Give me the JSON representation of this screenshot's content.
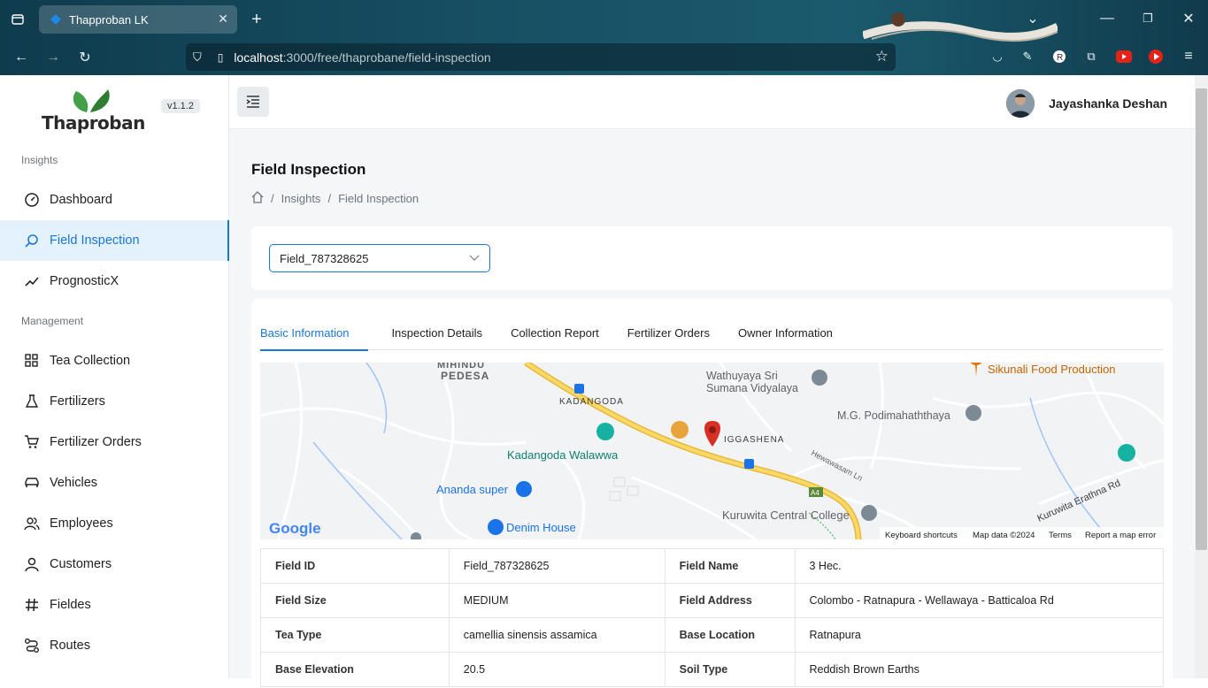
{
  "browser": {
    "tab_title": "Thapproban LK",
    "url_host": "localhost",
    "url_path": ":3000/free/thaprobane/field-inspection"
  },
  "sidebar": {
    "logo_text": "Thaproban",
    "version": "v1.1.2",
    "section_insights": "Insights",
    "section_management": "Management",
    "items": [
      {
        "label": "Dashboard",
        "icon": "gauge-icon"
      },
      {
        "label": "Field Inspection",
        "icon": "search-icon"
      },
      {
        "label": "PrognosticX",
        "icon": "trend-icon"
      },
      {
        "label": "Tea Collection",
        "icon": "grid-icon"
      },
      {
        "label": "Fertilizers",
        "icon": "flask-icon"
      },
      {
        "label": "Fertilizer Orders",
        "icon": "cart-icon"
      },
      {
        "label": "Vehicles",
        "icon": "car-icon"
      },
      {
        "label": "Employees",
        "icon": "users-icon"
      },
      {
        "label": "Customers",
        "icon": "user-icon"
      },
      {
        "label": "Fieldes",
        "icon": "hash-icon"
      },
      {
        "label": "Routes",
        "icon": "route-icon"
      }
    ]
  },
  "header": {
    "user_name": "Jayashanka Deshan"
  },
  "main": {
    "title": "Field Inspection",
    "breadcrumb": [
      "Insights",
      "Field Inspection"
    ],
    "field_select_value": "Field_787328625",
    "tabs": [
      "Basic Information",
      "Inspection Details",
      "Collection Report",
      "Fertilizer Orders",
      "Owner Information"
    ],
    "map": {
      "labels": [
        "MIHINDU",
        "PEDESA",
        "KADANGODA",
        "Wathuyaya Sri",
        "Sumana Vidyalaya",
        "Sikunali Food Production",
        "M.G. Podimahaththaya",
        "IGGASHENA",
        "Hewawasam Ln",
        "Kadangoda Walawwa",
        "Ananda super",
        "Kuruwita Central College",
        "Kuruwita Erathna Rd",
        "Denim House",
        "A4"
      ],
      "google": "Google",
      "footer": [
        "Keyboard shortcuts",
        "Map data ©2024",
        "Terms",
        "Report a map error"
      ]
    },
    "info_rows": [
      {
        "k1": "Field ID",
        "v1": "Field_787328625",
        "k2": "Field Name",
        "v2": "3 Hec."
      },
      {
        "k1": "Field Size",
        "v1": "MEDIUM",
        "k2": "Field Address",
        "v2": "Colombo - Ratnapura - Wellawaya - Batticaloa Rd"
      },
      {
        "k1": "Tea Type",
        "v1": "camellia sinensis assamica",
        "k2": "Base Location",
        "v2": "Ratnapura"
      },
      {
        "k1": "Base Elevation",
        "v1": "20.5",
        "k2": "Soil Type",
        "v2": "Reddish Brown Earths"
      }
    ]
  },
  "colors": {
    "accent": "#1976d2",
    "active_bg": "#e3f2fd",
    "road": "#f5c542",
    "pin": "#d93025"
  }
}
